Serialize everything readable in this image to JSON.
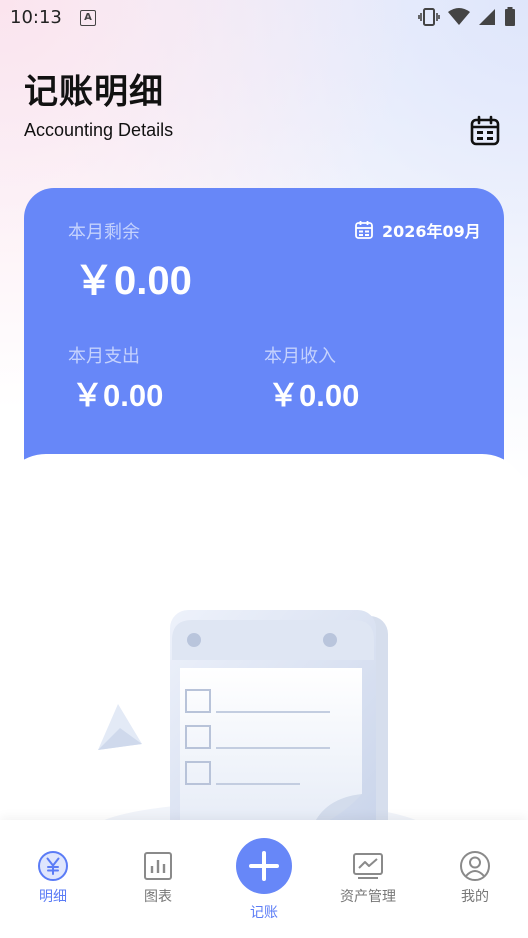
{
  "status_bar": {
    "time": "10:13",
    "notification_letter": "A"
  },
  "header": {
    "title": "记账明细",
    "subtitle": "Accounting Details"
  },
  "summary": {
    "remaining_label": "本月剩余",
    "remaining_value": "￥0.00",
    "month": "2026年09月",
    "expense_label": "本月支出",
    "expense_value": "￥0.00",
    "income_label": "本月收入",
    "income_value": "￥0.00"
  },
  "colors": {
    "accent": "#6787f8",
    "accent_text": "#5b7cf6",
    "label_muted": "#c5d2fd"
  },
  "nav": {
    "items": [
      {
        "label": "明细",
        "icon": "yen-circle-icon",
        "active": true
      },
      {
        "label": "图表",
        "icon": "bar-chart-icon",
        "active": false
      },
      {
        "label": "记账",
        "icon": "plus-icon",
        "active": false
      },
      {
        "label": "资产管理",
        "icon": "trend-monitor-icon",
        "active": false
      },
      {
        "label": "我的",
        "icon": "user-profile-icon",
        "active": false
      }
    ]
  }
}
